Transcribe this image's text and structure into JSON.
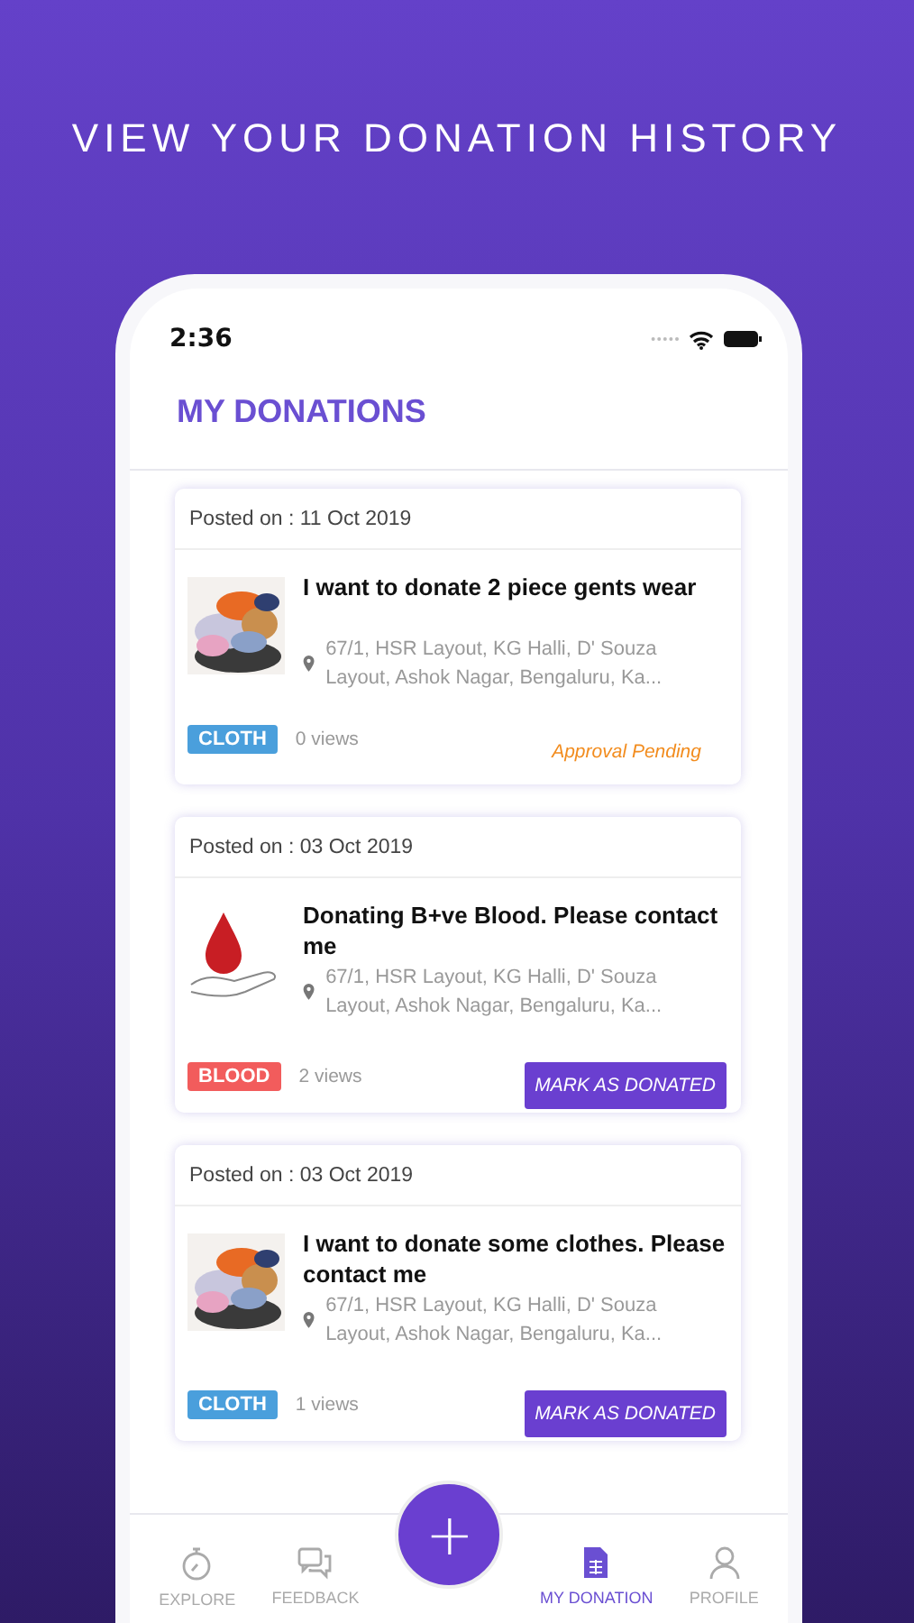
{
  "headline": "VIEW YOUR DONATION HISTORY",
  "status_bar": {
    "time": "2:36"
  },
  "header": {
    "title": "MY DONATIONS"
  },
  "donations": [
    {
      "posted": "Posted on : 11 Oct 2019",
      "kind": "cloth",
      "title": "I want to donate 2 piece gents wear",
      "address": "67/1, HSR Layout, KG Halli, D' Souza Layout, Ashok Nagar, Bengaluru, Ka...",
      "category": "CLOTH",
      "color": "#4a9fdc",
      "views": "0 views",
      "action": {
        "kind": "status",
        "text": "Approval Pending"
      }
    },
    {
      "posted": "Posted on : 03 Oct 2019",
      "kind": "blood",
      "title": "Donating B+ve Blood. Please contact me",
      "address": "67/1, HSR Layout, KG Halli, D' Souza Layout, Ashok Nagar, Bengaluru, Ka...",
      "category": "BLOOD",
      "color": "#f25c5c",
      "views": "2 views",
      "action": {
        "kind": "button",
        "text": "MARK AS DONATED"
      }
    },
    {
      "posted": "Posted on : 03 Oct 2019",
      "kind": "cloth",
      "title": "I want to donate some clothes. Please contact me",
      "address": "67/1, HSR Layout, KG Halli, D' Souza Layout, Ashok Nagar, Bengaluru, Ka...",
      "category": "CLOTH",
      "color": "#4a9fdc",
      "views": "1 views",
      "action": {
        "kind": "button",
        "text": "MARK AS DONATED"
      }
    }
  ],
  "fab": {
    "label": "+"
  },
  "nav": [
    {
      "label": "EXPLORE",
      "selected": false
    },
    {
      "label": "FEEDBACK",
      "selected": false
    },
    {
      "label": "MY DONATION",
      "selected": true
    },
    {
      "label": "PROFILE",
      "selected": false
    }
  ]
}
